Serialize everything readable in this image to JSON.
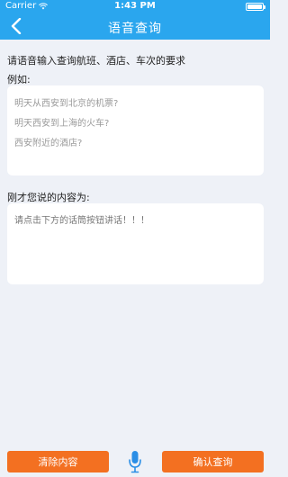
{
  "status_bar": {
    "carrier": "Carrier",
    "time": "1:43 PM"
  },
  "nav": {
    "title": "语音查询",
    "back_icon": "chevron-left-icon"
  },
  "content": {
    "instruction": "请语音输入查询航班、酒店、车次的要求",
    "example_label": "例如:",
    "examples": [
      "明天从西安到北京的机票?",
      "明天西安到上海的火车?",
      "西安附近的酒店?"
    ],
    "said_label": "刚才您说的内容为:",
    "said_placeholder": "请点击下方的话筒按钮讲话！！！"
  },
  "toolbar": {
    "clear_label": "清除内容",
    "confirm_label": "确认查询",
    "mic_icon": "microphone-icon"
  },
  "colors": {
    "nav_bg": "#2aa6ee",
    "button_bg": "#f37021",
    "mic": "#2a8ee6",
    "page_bg": "#eef1f7"
  }
}
